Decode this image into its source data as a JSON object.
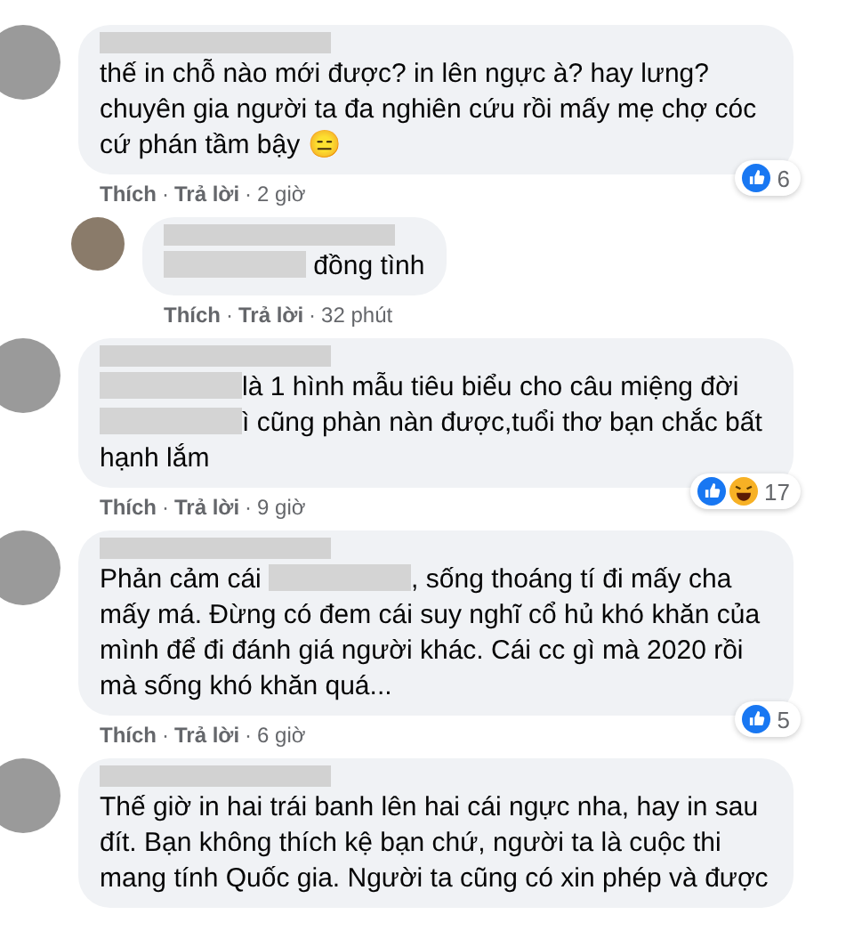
{
  "comments": [
    {
      "reply": false,
      "body": [
        {
          "kind": "text",
          "text": "thế in chỗ nào mới được? in lên ngực à? hay lưng? chuyên gia người ta đa nghiên cứu rồi mấy mẹ chợ cóc cứ phán tầm bậy 😑"
        }
      ],
      "reactions": [
        {
          "kind": "like"
        }
      ],
      "count": "6",
      "footer": [
        {
          "kind": "link",
          "text": "Thích"
        },
        {
          "kind": "sep",
          "text": "·"
        },
        {
          "kind": "link",
          "text": "Trả lời"
        },
        {
          "kind": "sep",
          "text": "·"
        },
        {
          "kind": "time",
          "text": "2 giờ"
        }
      ]
    },
    {
      "reply": true,
      "body": [
        {
          "kind": "redacted"
        },
        {
          "kind": "text",
          "text": " đồng tình"
        }
      ],
      "footer": [
        {
          "kind": "link",
          "text": "Thích"
        },
        {
          "kind": "sep",
          "text": "·"
        },
        {
          "kind": "link",
          "text": "Trả lời"
        },
        {
          "kind": "sep",
          "text": "·"
        },
        {
          "kind": "time",
          "text": "32 phút"
        }
      ]
    },
    {
      "reply": false,
      "body": [
        {
          "kind": "redacted"
        },
        {
          "kind": "text",
          "text": "là 1 hình mẫu tiêu biểu cho câu miệng đời"
        },
        {
          "kind": "redacted"
        },
        {
          "kind": "text",
          "text": "ì cũng phàn nàn được,tuổi thơ bạn chắc bất hạnh lắm"
        }
      ],
      "reactions": [
        {
          "kind": "like"
        },
        {
          "kind": "haha"
        }
      ],
      "count": "17",
      "footer": [
        {
          "kind": "link",
          "text": "Thích"
        },
        {
          "kind": "sep",
          "text": "·"
        },
        {
          "kind": "link",
          "text": "Trả lời"
        },
        {
          "kind": "sep",
          "text": "·"
        },
        {
          "kind": "time",
          "text": "9 giờ"
        }
      ]
    },
    {
      "reply": false,
      "body": [
        {
          "kind": "text",
          "text": "Phản cảm cái "
        },
        {
          "kind": "redacted"
        },
        {
          "kind": "text",
          "text": ", sống thoáng tí đi mấy cha mấy má. Đừng có đem cái suy nghĩ cổ hủ khó khăn của mình để đi đánh giá người khác. Cái cc gì mà 2020 rồi mà sống khó khăn quá..."
        }
      ],
      "reactions": [
        {
          "kind": "like"
        }
      ],
      "count": "5",
      "footer": [
        {
          "kind": "link",
          "text": "Thích"
        },
        {
          "kind": "sep",
          "text": "·"
        },
        {
          "kind": "link",
          "text": "Trả lời"
        },
        {
          "kind": "sep",
          "text": "·"
        },
        {
          "kind": "time",
          "text": "6 giờ"
        }
      ]
    },
    {
      "reply": false,
      "body": [
        {
          "kind": "text",
          "text": "Thế giờ in hai trái banh lên hai cái ngực nha, hay in sau đít. Bạn không thích kệ bạn chứ, người ta là cuộc thi mang tính Quốc gia. Người ta cũng có xin phép và được"
        }
      ]
    }
  ]
}
